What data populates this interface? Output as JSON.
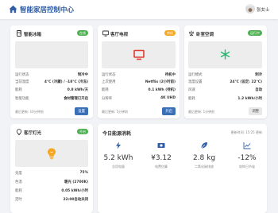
{
  "header": {
    "title": "智能家居控制中心",
    "user_name": "张女士"
  },
  "colors": {
    "green_badge": "#4caf50",
    "orange_badge": "#f5a623",
    "blue_button": "#3b6fb6",
    "tv_red": "#e03c31",
    "snow_green": "#2bb673",
    "bulb_orange": "#f5a623",
    "title_blue": "#2f5da6"
  },
  "fridge": {
    "title": "智能冰箱",
    "badge": "在线",
    "icon": "fridge-icon",
    "rows": [
      {
        "k": "运行状态",
        "v": "制冷中"
      },
      {
        "k": "当前温度",
        "v": "4°C (冷藏) / -18°C (冷冻)"
      },
      {
        "k": "能耗",
        "v": "0.8 kWh/天"
      },
      {
        "k": "智能功能",
        "v": "食材管理已开启"
      }
    ],
    "footer": "最后更新: 10分钟前",
    "button": "设置"
  },
  "tv": {
    "title": "客厅电视",
    "badge": "待机",
    "icon": "tv-icon",
    "rows": [
      {
        "k": "运行状态",
        "v": "待机中"
      },
      {
        "k": "上次使用",
        "v": "Netflix (2小时前)"
      },
      {
        "k": "能耗",
        "v": "0.1 kWh (待机)"
      },
      {
        "k": "分辨率",
        "v": "4K UHD"
      }
    ],
    "footer": "最后更新: 5分钟前",
    "button": "开启"
  },
  "ac": {
    "title": "卧室空调",
    "badge": "运行中",
    "icon": "ac-icon",
    "rows": [
      {
        "k": "运行模式",
        "v": "制冷"
      },
      {
        "k": "温度设置",
        "v": "24°C (设定: 22°C)"
      },
      {
        "k": "风速",
        "v": "自动"
      },
      {
        "k": "能耗",
        "v": "1.2 kWh/小时"
      }
    ],
    "footer": "最后更新: 1分钟前",
    "button": "调整"
  },
  "light": {
    "title": "客厅灯光",
    "badge": "开启",
    "icon": "light-icon",
    "rows": [
      {
        "k": "亮度",
        "v": "75%"
      },
      {
        "k": "色温",
        "v": "暖光 (2700K)"
      },
      {
        "k": "能耗",
        "v": "0.05 kWh/小时"
      },
      {
        "k": "定时",
        "v": "22:00自动关闭"
      }
    ]
  },
  "energy": {
    "title": "今日能源消耗",
    "updated": "更新时间: 15:25 更新",
    "items": [
      {
        "icon": "bolt-icon",
        "value": "5.2 kWh",
        "label": "总用电量"
      },
      {
        "icon": "money-icon",
        "value": "¥3.12",
        "label": "电费估算"
      },
      {
        "icon": "leaf-icon",
        "value": "2.8 kg",
        "label": "二氧化碳排放"
      },
      {
        "icon": "chart-icon",
        "value": "-12%",
        "label": "较昨日节省"
      }
    ]
  }
}
